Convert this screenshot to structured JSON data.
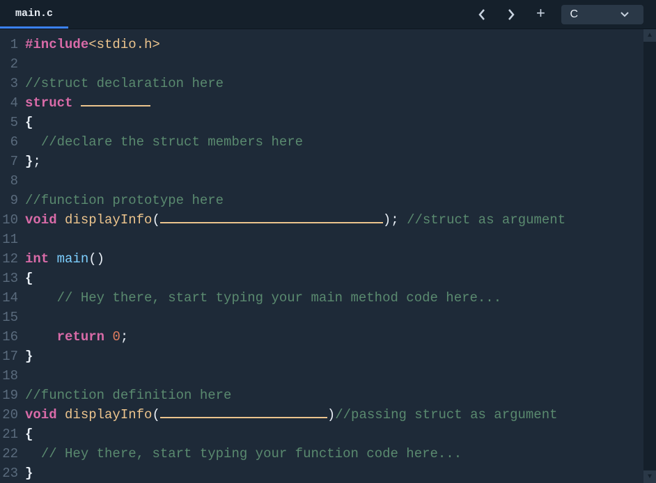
{
  "tab": {
    "filename": "main.c"
  },
  "controls": {
    "language": "C"
  },
  "lines": [
    {
      "n": 1,
      "segs": [
        {
          "t": "#include",
          "c": "kw-preproc"
        },
        {
          "t": "<stdio.h>",
          "c": "kw-include"
        }
      ]
    },
    {
      "n": 2,
      "segs": []
    },
    {
      "n": 3,
      "segs": [
        {
          "t": "//struct declaration here",
          "c": "comment"
        }
      ]
    },
    {
      "n": 4,
      "segs": [
        {
          "t": "struct",
          "c": "kw-struct"
        },
        {
          "t": " ",
          "c": ""
        },
        {
          "blank": "bl-short"
        }
      ]
    },
    {
      "n": 5,
      "segs": [
        {
          "t": "{",
          "c": "brace"
        }
      ]
    },
    {
      "n": 6,
      "segs": [
        {
          "t": "  ",
          "c": ""
        },
        {
          "t": "//declare the struct members here",
          "c": "comment"
        }
      ]
    },
    {
      "n": 7,
      "segs": [
        {
          "t": "}",
          "c": "brace"
        },
        {
          "t": ";",
          "c": "semi"
        }
      ]
    },
    {
      "n": 8,
      "segs": []
    },
    {
      "n": 9,
      "segs": [
        {
          "t": "//function prototype here",
          "c": "comment"
        }
      ]
    },
    {
      "n": 10,
      "segs": [
        {
          "t": "void",
          "c": "kw-void"
        },
        {
          "t": " ",
          "c": ""
        },
        {
          "t": "displayInfo",
          "c": "func"
        },
        {
          "t": "(",
          "c": "paren"
        },
        {
          "blank": "bl-long"
        },
        {
          "t": ")",
          "c": "paren"
        },
        {
          "t": ";",
          "c": "semi"
        },
        {
          "t": " ",
          "c": ""
        },
        {
          "t": "//struct as argument",
          "c": "comment"
        }
      ]
    },
    {
      "n": 11,
      "segs": []
    },
    {
      "n": 12,
      "segs": [
        {
          "t": "int",
          "c": "kw-int"
        },
        {
          "t": " ",
          "c": ""
        },
        {
          "t": "main",
          "c": "main-func"
        },
        {
          "t": "()",
          "c": "paren"
        }
      ]
    },
    {
      "n": 13,
      "segs": [
        {
          "t": "{",
          "c": "brace"
        }
      ]
    },
    {
      "n": 14,
      "segs": [
        {
          "t": "    ",
          "c": ""
        },
        {
          "t": "// Hey there, start typing your main method code here...",
          "c": "comment"
        }
      ]
    },
    {
      "n": 15,
      "segs": []
    },
    {
      "n": 16,
      "segs": [
        {
          "t": "    ",
          "c": ""
        },
        {
          "t": "return",
          "c": "kw-return"
        },
        {
          "t": " ",
          "c": ""
        },
        {
          "t": "0",
          "c": "num"
        },
        {
          "t": ";",
          "c": "semi"
        }
      ]
    },
    {
      "n": 17,
      "segs": [
        {
          "t": "}",
          "c": "brace"
        }
      ]
    },
    {
      "n": 18,
      "segs": []
    },
    {
      "n": 19,
      "segs": [
        {
          "t": "//function definition here",
          "c": "comment"
        }
      ]
    },
    {
      "n": 20,
      "segs": [
        {
          "t": "void",
          "c": "kw-void"
        },
        {
          "t": " ",
          "c": ""
        },
        {
          "t": "displayInfo",
          "c": "func"
        },
        {
          "t": "(",
          "c": "paren"
        },
        {
          "blank": "bl-med"
        },
        {
          "t": ")",
          "c": "paren"
        },
        {
          "t": "//passing struct as argument",
          "c": "comment"
        }
      ]
    },
    {
      "n": 21,
      "segs": [
        {
          "t": "{",
          "c": "brace"
        }
      ]
    },
    {
      "n": 22,
      "segs": [
        {
          "t": "  ",
          "c": ""
        },
        {
          "t": "// Hey there, start typing your function code here...",
          "c": "comment"
        }
      ]
    },
    {
      "n": 23,
      "segs": [
        {
          "t": "}",
          "c": "brace"
        }
      ]
    }
  ]
}
